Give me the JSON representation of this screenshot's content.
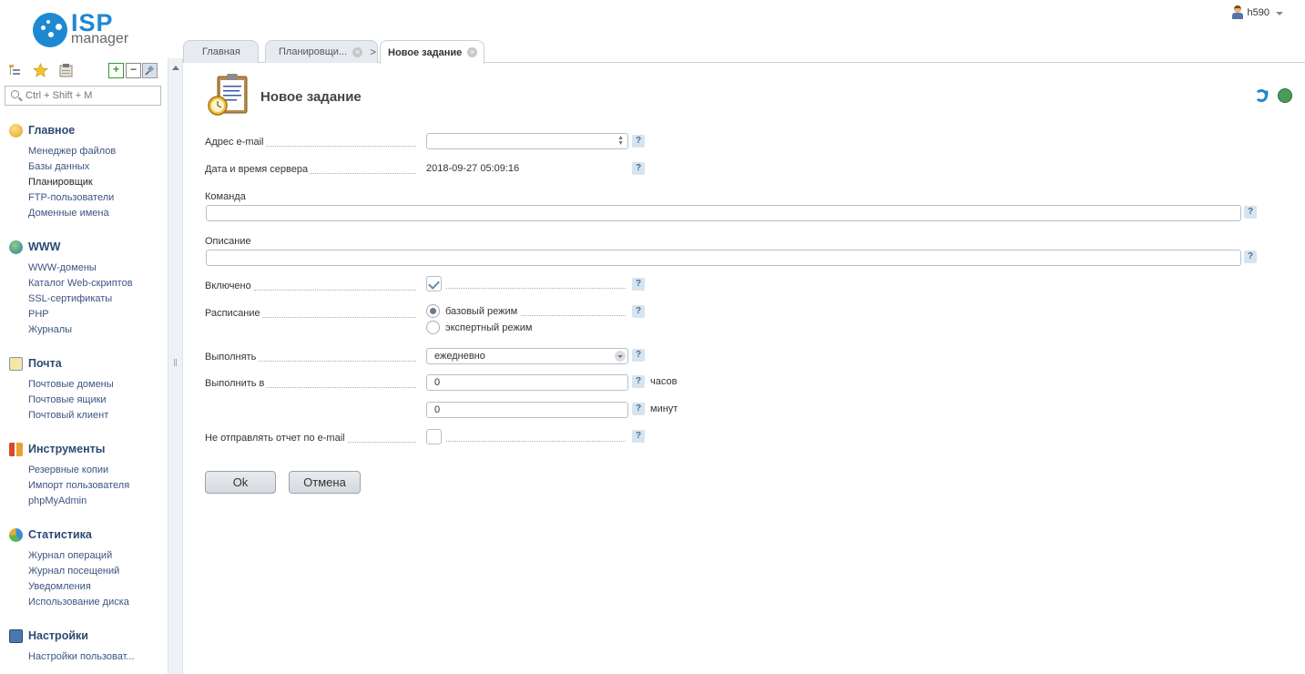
{
  "logo": {
    "isp": "ISP",
    "manager": "manager"
  },
  "user": {
    "name": "h590"
  },
  "search": {
    "placeholder": "Ctrl + Shift + M"
  },
  "menu": [
    {
      "title": "Главное",
      "icon": "home-icon",
      "items": [
        "Менеджер файлов",
        "Базы данных",
        "Планировщик",
        "FTP-пользователи",
        "Доменные имена"
      ]
    },
    {
      "title": "WWW",
      "icon": "globe-icon",
      "items": [
        "WWW-домены",
        "Каталог Web-скриптов",
        "SSL-сертификаты",
        "PHP",
        "Журналы"
      ]
    },
    {
      "title": "Почта",
      "icon": "mail-icon",
      "items": [
        "Почтовые домены",
        "Почтовые ящики",
        "Почтовый клиент"
      ]
    },
    {
      "title": "Инструменты",
      "icon": "tools-icon",
      "items": [
        "Резервные копии",
        "Импорт пользователя",
        "phpMyAdmin"
      ]
    },
    {
      "title": "Статистика",
      "icon": "pie-chart-icon",
      "items": [
        "Журнал операций",
        "Журнал посещений",
        "Уведомления",
        "Использование диска"
      ]
    },
    {
      "title": "Настройки",
      "icon": "settings-icon",
      "items": [
        "Настройки пользоват..."
      ]
    }
  ],
  "tabs": {
    "main": "Главная",
    "scheduler": "Планировщи...",
    "new_task": "Новое задание",
    "arrow": ">",
    "close": "×"
  },
  "form": {
    "title": "Новое задание",
    "email_label": "Адрес e-mail",
    "email_value": "",
    "server_time_label": "Дата и время сервера",
    "server_time_value": "2018-09-27 05:09:16",
    "command_label": "Команда",
    "command_value": "",
    "description_label": "Описание",
    "description_value": "",
    "enabled_label": "Включено",
    "enabled": true,
    "schedule_label": "Расписание",
    "schedule_basic": "базовый режим",
    "schedule_expert": "экспертный режим",
    "run_label": "Выполнять",
    "run_value": "ежедневно",
    "run_at_label": "Выполнить в",
    "hours_value": "0",
    "hours_unit": "часов",
    "minutes_value": "0",
    "minutes_unit": "минут",
    "no_report_label": "Не отправлять отчет по e-mail",
    "no_report": false,
    "help": "?",
    "ok": "Ok",
    "cancel": "Отмена"
  },
  "colors": {
    "accent": "#1e88d2",
    "link": "#3a5580",
    "group_title": "#2c4a72"
  }
}
